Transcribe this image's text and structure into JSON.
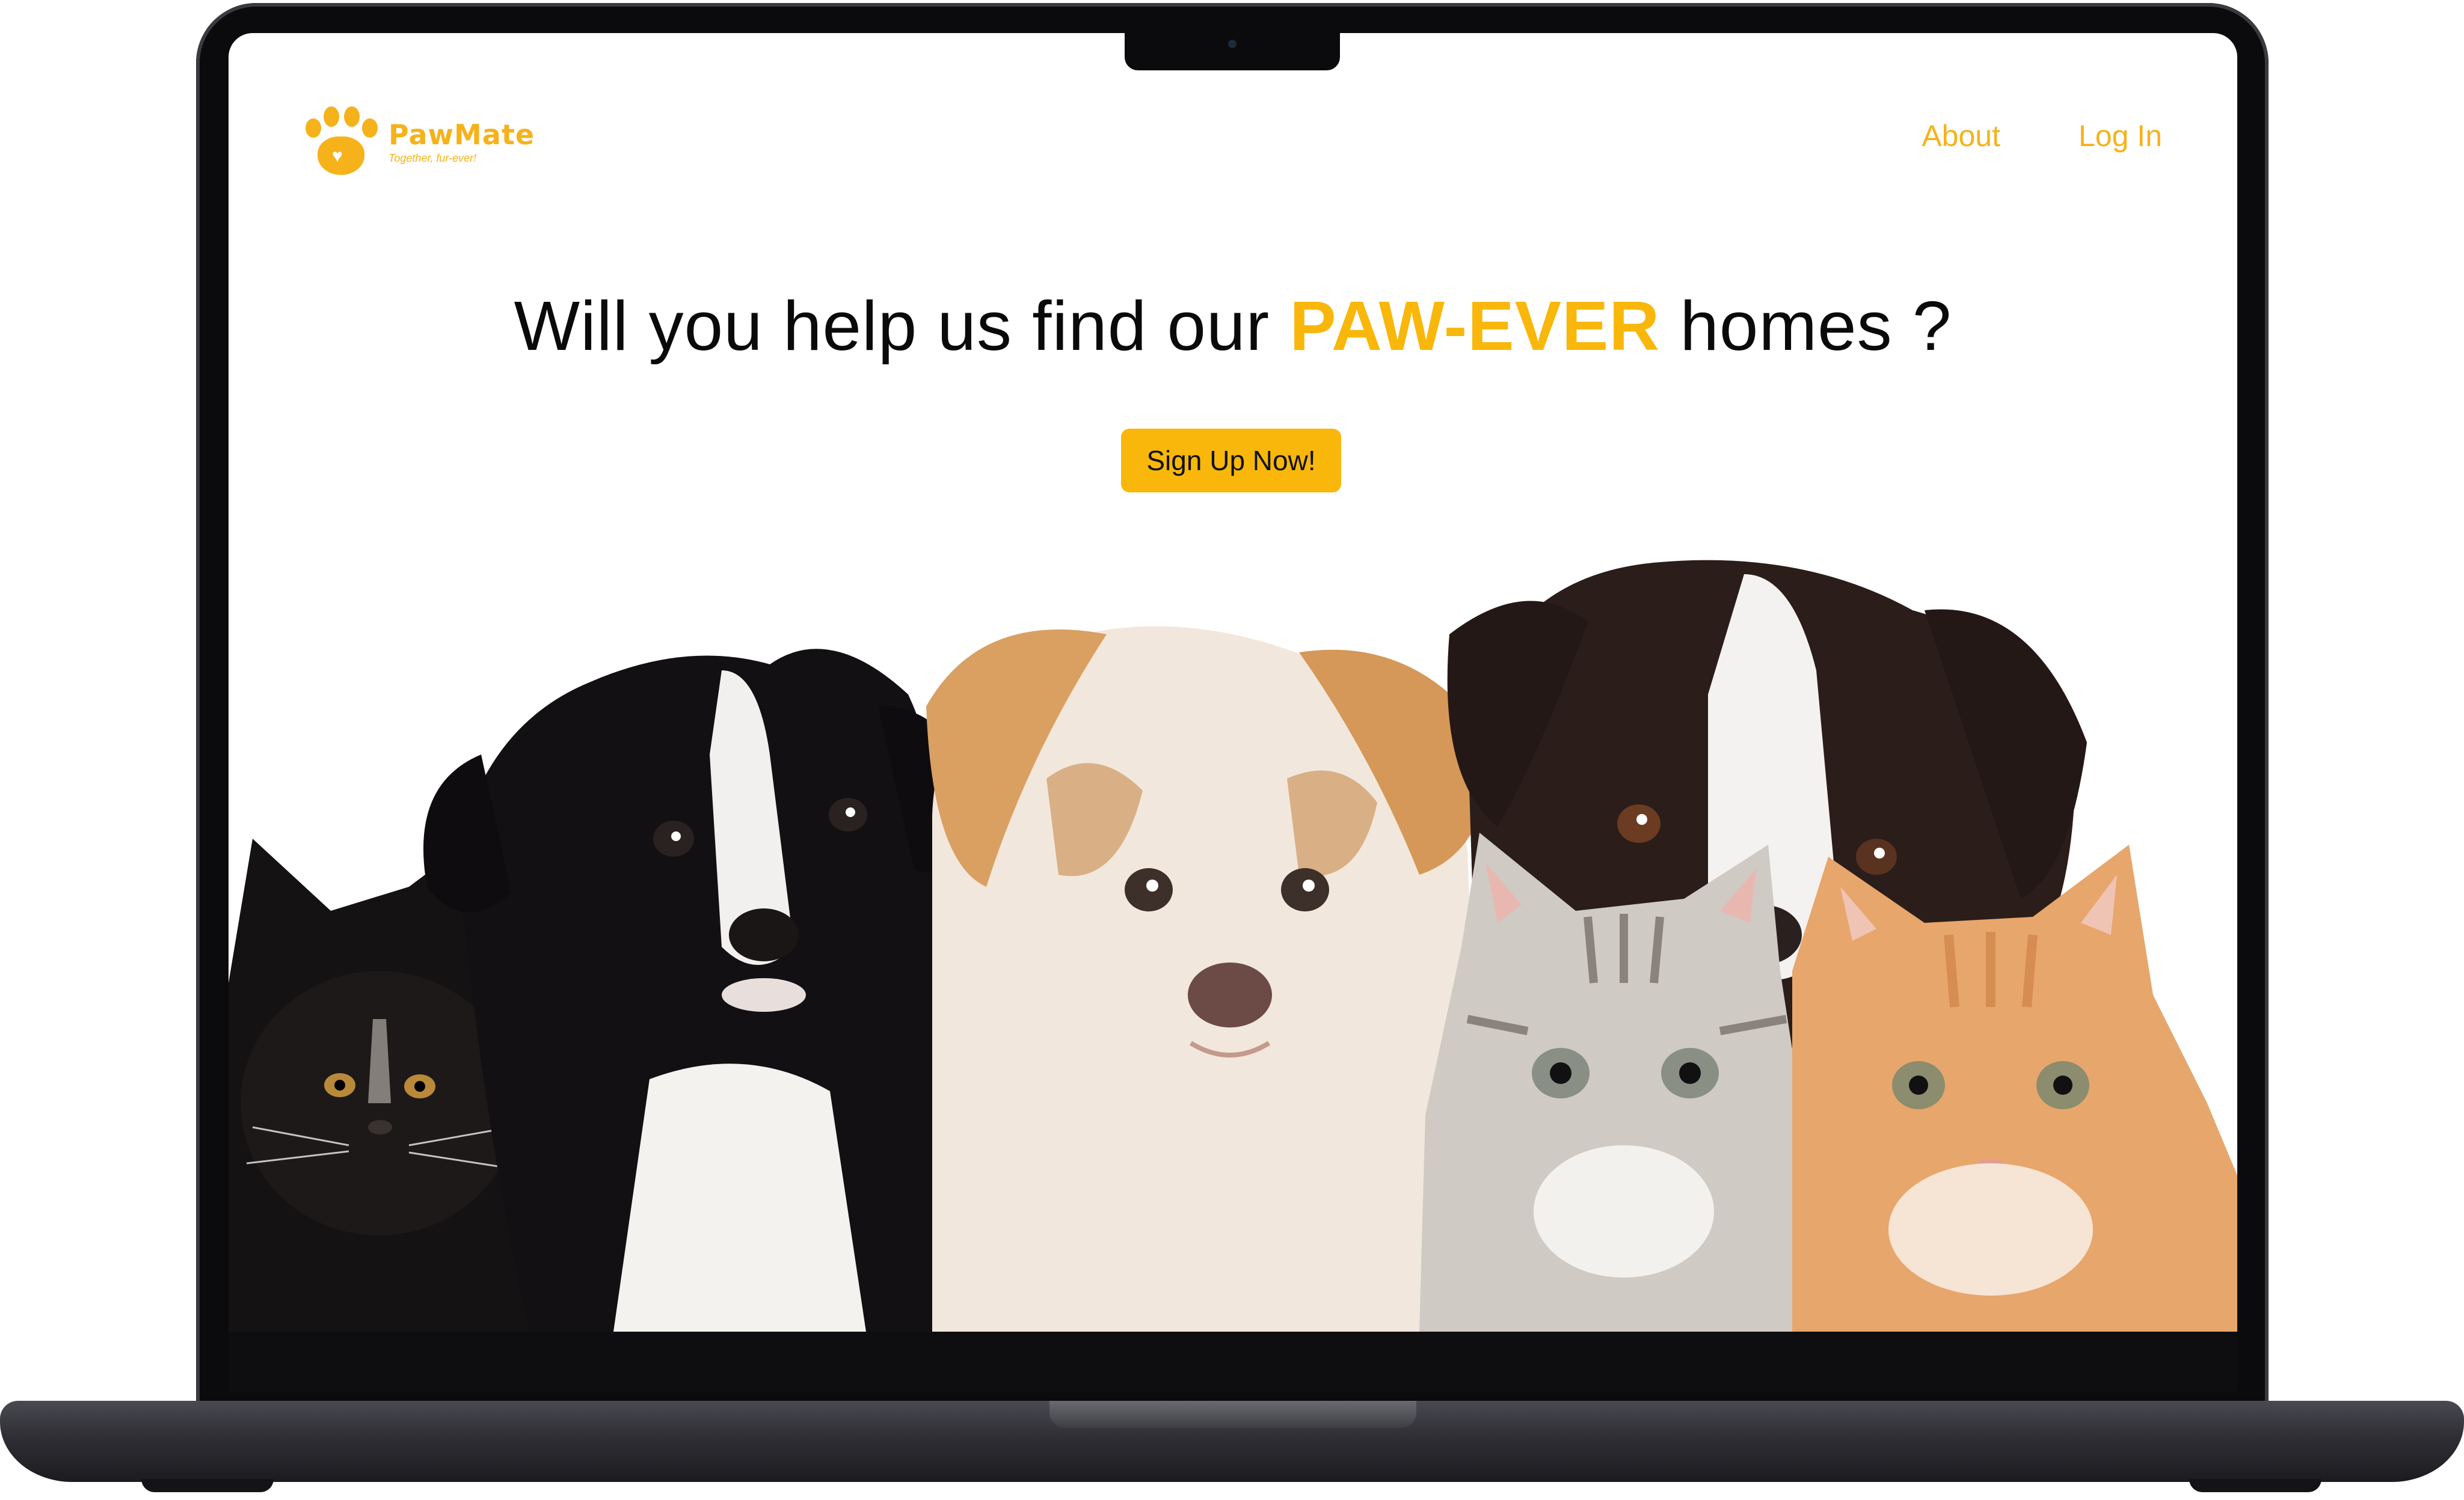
{
  "site": {
    "brand": "PawMate",
    "tagline": "Together, fur-ever!",
    "accent_color": "#f8b70a"
  },
  "nav": {
    "about_label": "About",
    "login_label": "Log In"
  },
  "hero": {
    "headline_before": "Will you help us find our ",
    "headline_highlight": "PAW-EVER",
    "headline_after": " homes ?",
    "cta_label": "Sign Up Now!"
  },
  "icons": {
    "logo": "paw-print-icon",
    "logo_heart": "heart-icon"
  }
}
